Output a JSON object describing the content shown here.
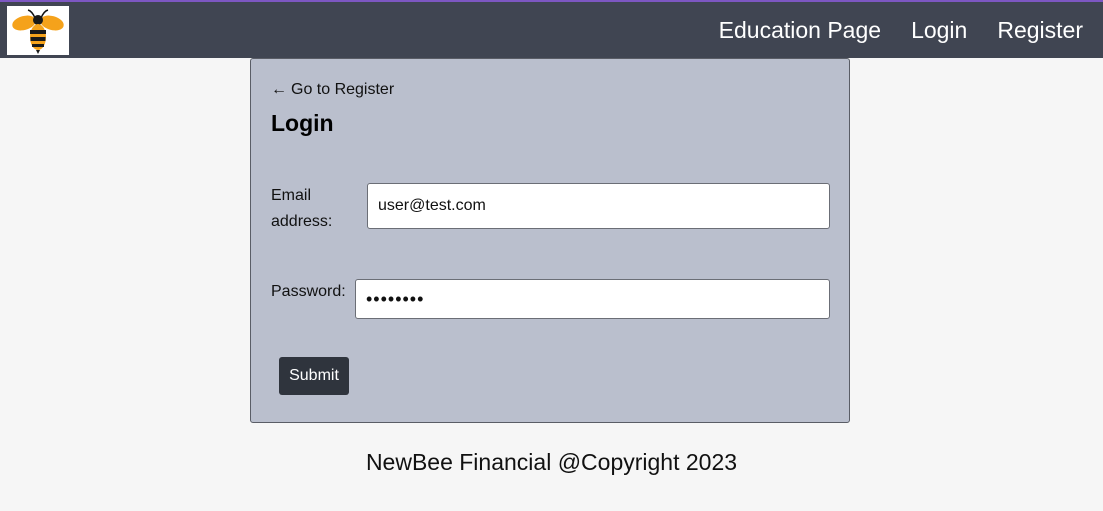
{
  "navbar": {
    "logo_alt": "NewBee logo",
    "links": [
      {
        "label": "Education Page"
      },
      {
        "label": "Login"
      },
      {
        "label": "Register"
      }
    ]
  },
  "login_card": {
    "back_arrow": "←",
    "back_link": "Go to Register",
    "title": "Login",
    "email_label": "Email address:",
    "email_value": "user@test.com",
    "password_label": "Password:",
    "password_value": "••••••••",
    "submit_label": "Submit"
  },
  "footer": {
    "text": "NewBee Financial @Copyright 2023"
  },
  "colors": {
    "navbar_bg": "#404552",
    "card_bg": "#babfcd",
    "button_bg": "#2f343d",
    "page_bg": "#f6f6f6"
  },
  "icons": {
    "logo": "bee-logo-icon",
    "back": "arrow-left-icon"
  }
}
